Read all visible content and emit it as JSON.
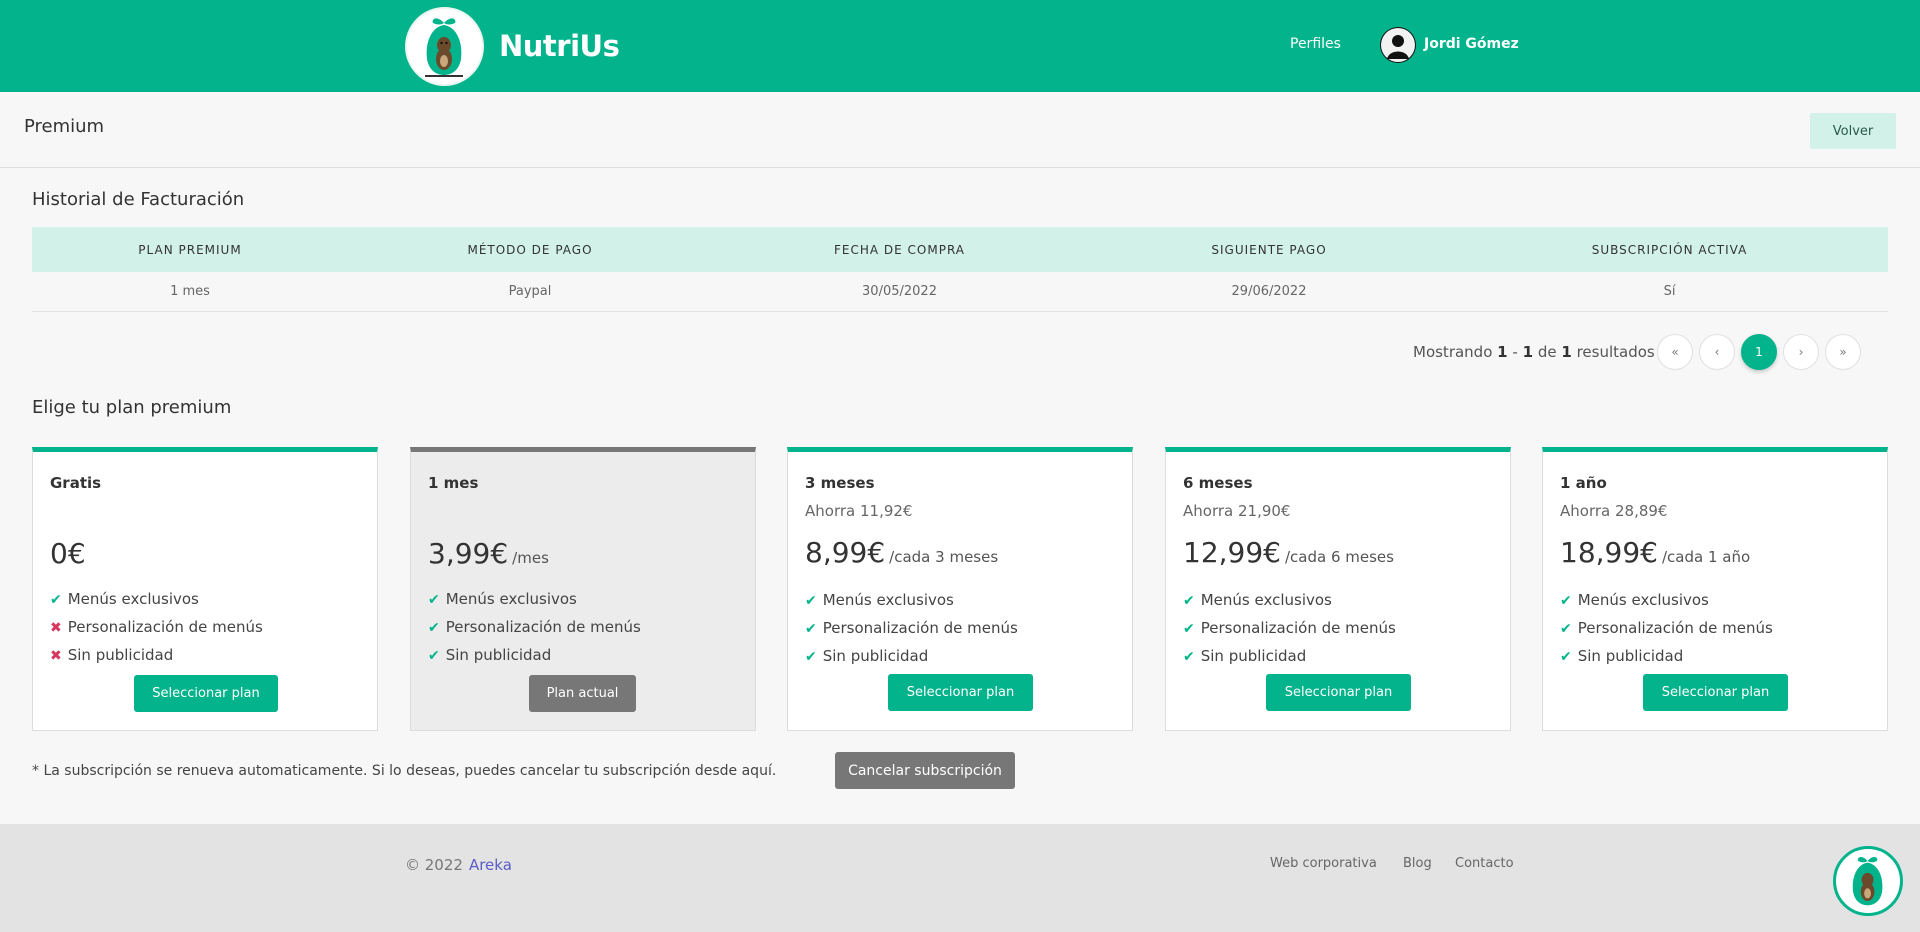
{
  "header": {
    "brand": "NutriUs",
    "nav_profiles": "Perfiles",
    "user_name": "Jordi Gómez",
    "accent_color": "#02b38c"
  },
  "page": {
    "title": "Premium",
    "back_button": "Volver"
  },
  "billing": {
    "title": "Historial de Facturación",
    "columns": [
      "PLAN PREMIUM",
      "MÉTODO DE PAGO",
      "FECHA DE COMPRA",
      "SIGUIENTE PAGO",
      "SUBSCRIPCIÓN ACTIVA"
    ],
    "rows": [
      [
        "1 mes",
        "Paypal",
        "30/05/2022",
        "29/06/2022",
        "Sí"
      ]
    ],
    "showing_prefix": "Mostrando",
    "from": "1",
    "dash": "-",
    "to": "1",
    "of": "de",
    "total": "1",
    "results": "resultados",
    "pagination": {
      "first": "«",
      "prev": "‹",
      "current": "1",
      "next": "›",
      "last": "»"
    }
  },
  "plans": {
    "title": "Elige tu plan premium",
    "items": [
      {
        "name": "Gratis",
        "save": "",
        "price": "0€",
        "period": "",
        "features": [
          {
            "label": "Menús exclusivos",
            "mark": "✔"
          },
          {
            "label": "Personalización de menús",
            "mark": "✖"
          },
          {
            "label": "Sin publicidad",
            "mark": "✖"
          }
        ],
        "button": "Seleccionar plan"
      },
      {
        "name": "1 mes",
        "save": "",
        "price": "3,99€",
        "period": "/mes",
        "features": [
          {
            "label": "Menús exclusivos",
            "mark": "✔"
          },
          {
            "label": "Personalización de menús",
            "mark": "✔"
          },
          {
            "label": "Sin publicidad",
            "mark": "✔"
          }
        ],
        "button": "Plan actual"
      },
      {
        "name": "3 meses",
        "save": "Ahorra 11,92€",
        "price": "8,99€",
        "period": "/cada 3 meses",
        "features": [
          {
            "label": "Menús exclusivos",
            "mark": "✔"
          },
          {
            "label": "Personalización de menús",
            "mark": "✔"
          },
          {
            "label": "Sin publicidad",
            "mark": "✔"
          }
        ],
        "button": "Seleccionar plan"
      },
      {
        "name": "6 meses",
        "save": "Ahorra 21,90€",
        "price": "12,99€",
        "period": "/cada 6 meses",
        "features": [
          {
            "label": "Menús exclusivos",
            "mark": "✔"
          },
          {
            "label": "Personalización de menús",
            "mark": "✔"
          },
          {
            "label": "Sin publicidad",
            "mark": "✔"
          }
        ],
        "button": "Seleccionar plan"
      },
      {
        "name": "1 año",
        "save": "Ahorra 28,89€",
        "price": "18,99€",
        "period": "/cada 1 año",
        "features": [
          {
            "label": "Menús exclusivos",
            "mark": "✔"
          },
          {
            "label": "Personalización de menús",
            "mark": "✔"
          },
          {
            "label": "Sin publicidad",
            "mark": "✔"
          }
        ],
        "button": "Seleccionar plan"
      }
    ],
    "note": "* La subscripción se renueva automaticamente. Si lo deseas, puedes cancelar tu subscripción desde aquí.",
    "cancel_button": "Cancelar subscripción"
  },
  "footer": {
    "copyright": "© 2022",
    "company": "Areka",
    "links": [
      "Web corporativa",
      "Blog",
      "Contacto"
    ]
  }
}
